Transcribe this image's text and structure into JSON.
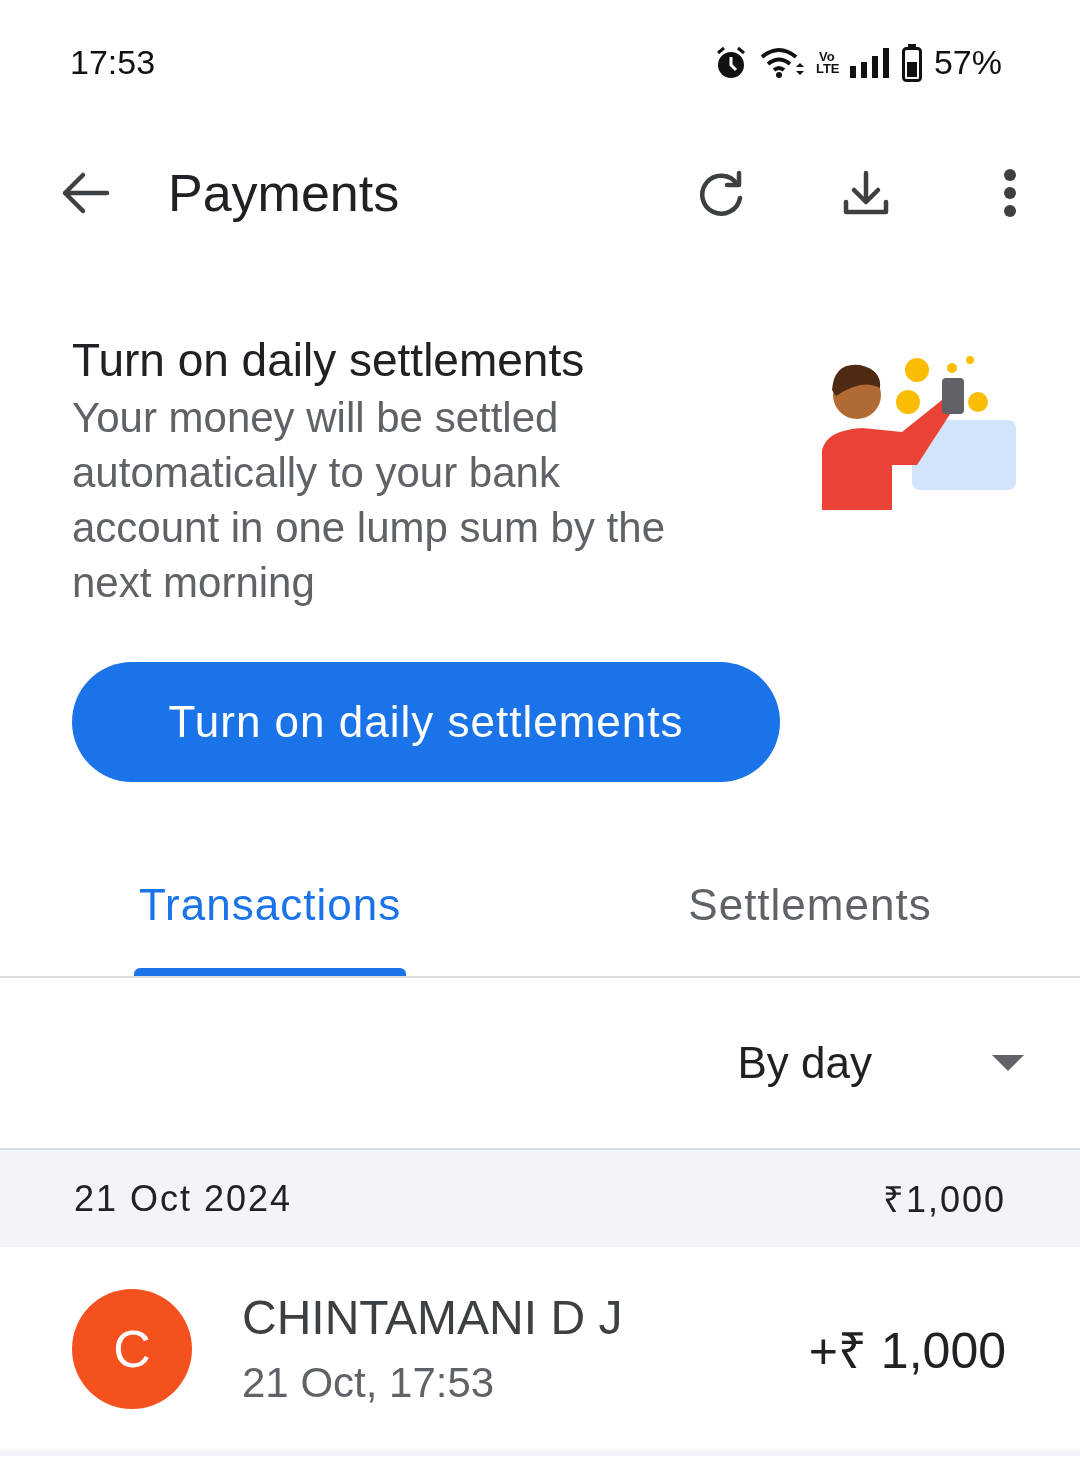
{
  "status_bar": {
    "time": "17:53",
    "network": "Vo LTE",
    "battery": "57%"
  },
  "app_bar": {
    "title": "Payments"
  },
  "banner": {
    "title": "Turn on daily settlements",
    "body": "Your money will be settled automatically to your bank account in one lump sum by the next morning",
    "button": "Turn on daily settlements"
  },
  "tabs": [
    {
      "label": "Transactions",
      "selected": true
    },
    {
      "label": "Settlements",
      "selected": false
    }
  ],
  "filter": {
    "value": "By day"
  },
  "groups": [
    {
      "date": "21 Oct 2024",
      "total": "₹1,000",
      "transactions": [
        {
          "initial": "C",
          "color": "#f4511e",
          "name": "CHINTAMANI D J",
          "time": "21 Oct, 17:53",
          "amount": "+₹ 1,000"
        }
      ]
    }
  ]
}
